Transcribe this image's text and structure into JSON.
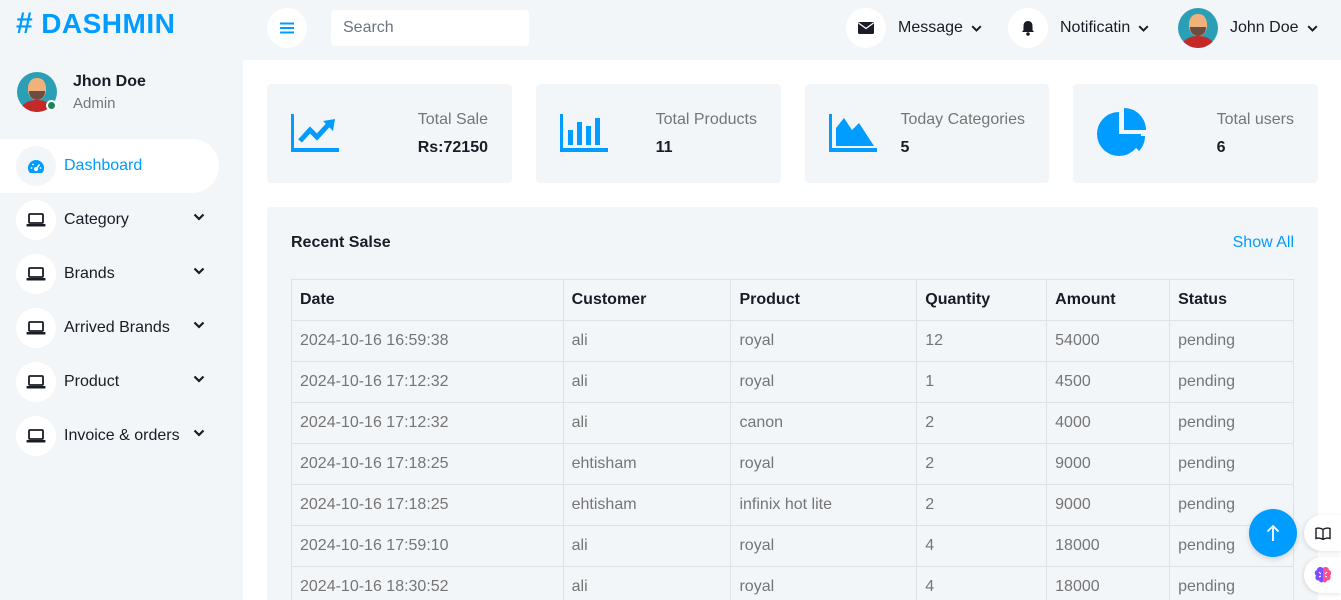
{
  "brand": {
    "hash": "#",
    "name": "DASHMIN"
  },
  "profile": {
    "name": "Jhon Doe",
    "role": "Admin"
  },
  "sidebar": {
    "items": [
      {
        "label": "Dashboard",
        "icon": "gauge-icon",
        "active": true
      },
      {
        "label": "Category",
        "icon": "laptop-icon"
      },
      {
        "label": "Brands",
        "icon": "laptop-icon"
      },
      {
        "label": "Arrived Brands",
        "icon": "laptop-icon"
      },
      {
        "label": "Product",
        "icon": "laptop-icon"
      },
      {
        "label": "Invoice & orders",
        "icon": "laptop-icon"
      }
    ]
  },
  "topbar": {
    "search_placeholder": "Search",
    "message_label": "Message",
    "notification_label": "Notificatin",
    "user_label": "John Doe"
  },
  "cards": [
    {
      "title": "Total Sale",
      "value": "Rs:72150",
      "icon": "chart-line-icon"
    },
    {
      "title": "Total Products",
      "value": "11",
      "icon": "chart-bar-icon"
    },
    {
      "title": "Today Categories",
      "value": "5",
      "icon": "chart-area-icon"
    },
    {
      "title": "Total users",
      "value": "6",
      "icon": "chart-pie-icon"
    }
  ],
  "sales": {
    "title": "Recent Salse",
    "show_all": "Show All",
    "columns": [
      "Date",
      "Customer",
      "Product",
      "Quantity",
      "Amount",
      "Status"
    ],
    "rows": [
      [
        "2024-10-16 16:59:38",
        "ali",
        "royal",
        "12",
        "54000",
        "pending"
      ],
      [
        "2024-10-16 17:12:32",
        "ali",
        "royal",
        "1",
        "4500",
        "pending"
      ],
      [
        "2024-10-16 17:12:32",
        "ali",
        "canon",
        "2",
        "4000",
        "pending"
      ],
      [
        "2024-10-16 17:18:25",
        "ehtisham",
        "royal",
        "2",
        "9000",
        "pending"
      ],
      [
        "2024-10-16 17:18:25",
        "ehtisham",
        "infinix hot lite",
        "2",
        "9000",
        "pending"
      ],
      [
        "2024-10-16 17:59:10",
        "ali",
        "royal",
        "4",
        "18000",
        "pending"
      ],
      [
        "2024-10-16 18:30:52",
        "ali",
        "royal",
        "4",
        "18000",
        "pending"
      ]
    ]
  },
  "colors": {
    "primary": "#009cff",
    "light": "#f3f6f9",
    "dark": "#191c24",
    "online": "#198754"
  }
}
